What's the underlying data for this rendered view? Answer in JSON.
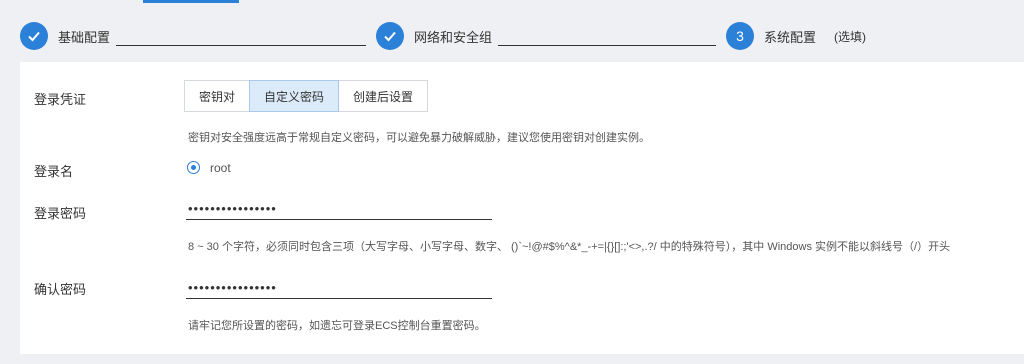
{
  "steps": [
    {
      "label": "基础配置",
      "state": "done",
      "icon": "check-icon"
    },
    {
      "label": "网络和安全组",
      "state": "done",
      "icon": "check-icon"
    },
    {
      "label": "系统配置",
      "number": "3",
      "state": "current",
      "optional": "(选填)"
    }
  ],
  "colors": {
    "accent": "#2b80d8",
    "tab_active_bg": "#dcebf9",
    "page_bg": "#eef0f3"
  },
  "form": {
    "credential_label": "登录凭证",
    "credential_tabs": [
      "密钥对",
      "自定义密码",
      "创建后设置"
    ],
    "credential_selected": "自定义密码",
    "credential_hint": "密钥对安全强度远高于常规自定义密码，可以避免暴力破解威胁，建议您使用密钥对创建实例。",
    "login_name_label": "登录名",
    "login_name_value": "root",
    "password_label": "登录密码",
    "password_value": "••••••••••••••••",
    "password_hint": "8 ~ 30 个字符，必须同时包含三项（大写字母、小写字母、数字、 ()`~!@#$%^&*_-+=|{}[]:;'<>,.?/ 中的特殊符号），其中 Windows 实例不能以斜线号（/）开头",
    "confirm_label": "确认密码",
    "confirm_value": "••••••••••••••••",
    "confirm_hint": "请牢记您所设置的密码，如遗忘可登录ECS控制台重置密码。"
  }
}
